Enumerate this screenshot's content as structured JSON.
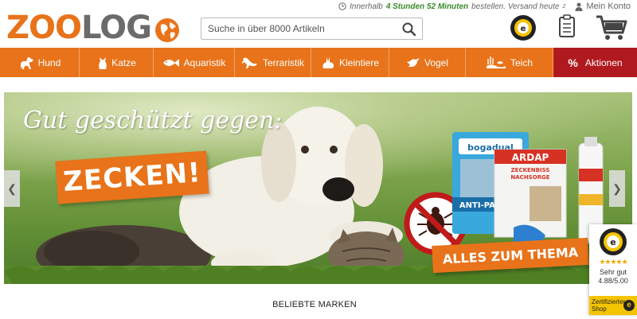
{
  "header": {
    "logo": {
      "part1": "ZOO",
      "part2": "LOG",
      "part3": "O"
    },
    "delivery": {
      "prefix": "Innerhalb",
      "time": "4 Stunden 52 Minuten",
      "suffix": "bestellen. Versand heute",
      "footnote": "2"
    },
    "account_label": "Mein Konto",
    "search": {
      "placeholder": "Suche in über 8000 Artikeln"
    },
    "icons": [
      "clock-icon",
      "user-icon",
      "search-icon",
      "trusted-shops-icon",
      "wishlist-icon",
      "cart-icon"
    ]
  },
  "nav": {
    "items": [
      {
        "label": "Hund",
        "icon": "dog-icon"
      },
      {
        "label": "Katze",
        "icon": "cat-icon"
      },
      {
        "label": "Aquaristik",
        "icon": "fish-icon"
      },
      {
        "label": "Terraristik",
        "icon": "lizard-icon"
      },
      {
        "label": "Kleintiere",
        "icon": "rabbit-icon"
      },
      {
        "label": "Vogel",
        "icon": "bird-icon"
      },
      {
        "label": "Teich",
        "icon": "pond-icon"
      }
    ],
    "promo": {
      "symbol": "%",
      "label": "Aktionen"
    }
  },
  "hero": {
    "headline": "Gut geschützt gegen:",
    "highlight": "ZECKEN!",
    "cta": "ALLES ZUM THEMA",
    "products": [
      "bogadual",
      "ANTI-PARASIT",
      "ARDAP",
      "ZECKENBISS NACHSORGE"
    ]
  },
  "trusted_widget": {
    "stars": "★★★★★",
    "rating_label": "Sehr gut",
    "score": "4.88/5.00",
    "cert_line1": "Zertifizierter",
    "cert_line2": "Shop"
  },
  "section_title": "BELIEBTE MARKEN",
  "colors": {
    "brand_orange": "#e8731a",
    "promo_red": "#b0191e",
    "delivery_green": "#3a8a2a",
    "trusted_yellow": "#f5c400"
  }
}
